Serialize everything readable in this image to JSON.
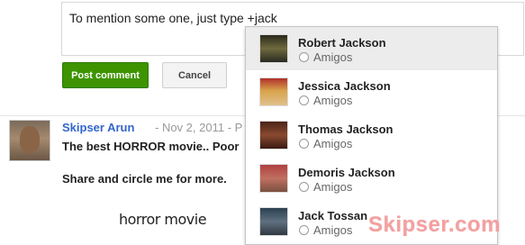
{
  "composer": {
    "text": "To mention some one, just type +jack",
    "post_label": "Post comment",
    "cancel_label": "Cancel"
  },
  "post": {
    "author": "Skipser Arun",
    "meta": "- Nov 2, 2011 - P",
    "line1": "The best HORROR movie.. Poor",
    "line2": "Share and circle me for more.",
    "attachment_title": "horror movie"
  },
  "suggestions": [
    {
      "name": "Robert Jackson",
      "group": "Amigos",
      "photo_bg": "linear-gradient(180deg,#2b2a1c 0%,#6e6a3e 50%,#2a2a22 100%)"
    },
    {
      "name": "Jessica Jackson",
      "group": "Amigos",
      "photo_bg": "linear-gradient(180deg,#b0302a 0%,#d8a24a 45%,#e0c08c 100%)"
    },
    {
      "name": "Thomas Jackson",
      "group": "Amigos",
      "photo_bg": "linear-gradient(180deg,#4a2418 0%,#8a4a30 50%,#3a1a12 100%)"
    },
    {
      "name": "Demoris Jackson",
      "group": "Amigos",
      "photo_bg": "linear-gradient(180deg,#b04040 0%,#c07060 50%,#7a5040 100%)"
    },
    {
      "name": "Jack Tossan",
      "group": "Amigos",
      "photo_bg": "linear-gradient(180deg,#2a4050 0%,#607080 50%,#303840 100%)"
    }
  ],
  "watermark": "Skipser.com",
  "colors": {
    "primary_button": "#3d9400",
    "link": "#3366cc",
    "watermark": "#f4a0a0"
  }
}
